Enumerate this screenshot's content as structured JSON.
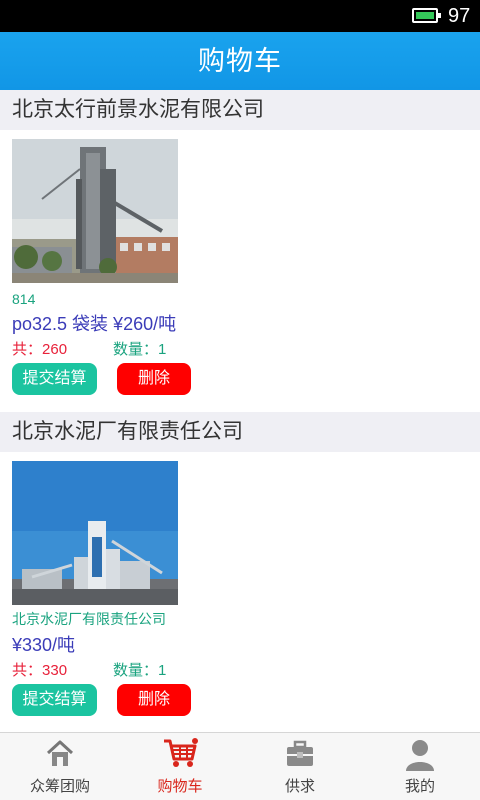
{
  "status_bar": {
    "battery_level": "97"
  },
  "header": {
    "title": "购物车"
  },
  "cart": [
    {
      "shop_name": "北京太行前景水泥有限公司",
      "product_name": "814",
      "spec": "po32.5 袋装 ¥260/吨",
      "total_label": "共：",
      "total_value": "260",
      "qty_label": "数量：",
      "qty_value": "1",
      "submit_label": "提交结算",
      "delete_label": "删除"
    },
    {
      "shop_name": "北京水泥厂有限责任公司",
      "product_name": "北京水泥厂有限责任公司",
      "spec": "¥330/吨",
      "total_label": "共：",
      "total_value": "330",
      "qty_label": "数量：",
      "qty_value": "1",
      "submit_label": "提交结算",
      "delete_label": "删除"
    }
  ],
  "tabbar": {
    "items": [
      {
        "label": "众筹团购",
        "icon": "home-icon"
      },
      {
        "label": "购物车",
        "icon": "cart-icon",
        "active": true
      },
      {
        "label": "供求",
        "icon": "briefcase-icon"
      },
      {
        "label": "我的",
        "icon": "user-icon"
      }
    ]
  },
  "colors": {
    "title_bar": "#1196e6",
    "submit_button": "#1bc4a0",
    "delete_button": "#ff0000",
    "active_tab": "#d9261c"
  }
}
